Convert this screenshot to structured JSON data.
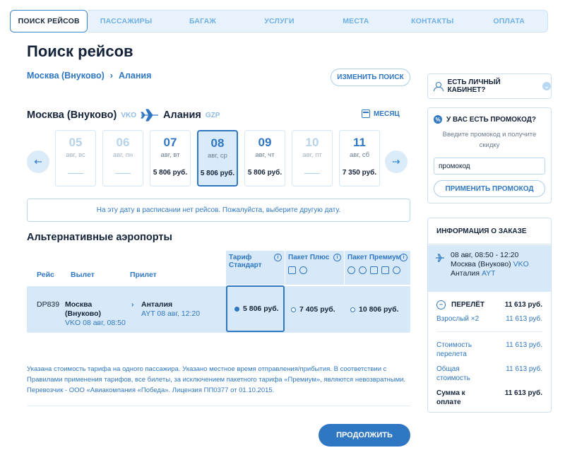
{
  "stepper": [
    "ПОИСК РЕЙСОВ",
    "ПАССАЖИРЫ",
    "БАГАЖ",
    "УСЛУГИ",
    "МЕСТА",
    "КОНТАКТЫ",
    "ОПЛАТА"
  ],
  "active_step": 0,
  "page_title": "Поиск рейсов",
  "breadcrumb": {
    "from": "Москва (Внуково)",
    "sep": "›",
    "to": "Алания"
  },
  "change_search": "ИЗМЕНИТЬ ПОИСК",
  "route": {
    "from": "Москва (Внуково)",
    "from_code": "VKO",
    "to": "Алания",
    "to_code": "GZP"
  },
  "month_label": "МЕСЯЦ",
  "dates": [
    {
      "day": "05",
      "wd": "авг, вс",
      "price": ""
    },
    {
      "day": "06",
      "wd": "авг, пн",
      "price": ""
    },
    {
      "day": "07",
      "wd": "авг, вт",
      "price": "5 806 руб."
    },
    {
      "day": "08",
      "wd": "авг, ср",
      "price": "5 806 руб."
    },
    {
      "day": "09",
      "wd": "авг, чт",
      "price": "5 806 руб."
    },
    {
      "day": "10",
      "wd": "авг, пт",
      "price": ""
    },
    {
      "day": "11",
      "wd": "авг, сб",
      "price": "7 350 руб."
    }
  ],
  "notice": "На эту дату в расписании нет рейсов. Пожалуйста, выберите другую дату.",
  "alt_title": "Альтернативные аэропорты",
  "table": {
    "h_flight": "Рейс",
    "h_dep": "Вылет",
    "h_arr": "Прилет",
    "t_standard": "Тариф Стандарт",
    "t_plus": "Пакет Плюс",
    "t_premium": "Пакет Премиум",
    "flight_no": "DP839",
    "dep_city1": "Москва",
    "dep_city2": "(Внуково)",
    "dep_code": "VKO",
    "dep_time": "08 авг, 08:50",
    "arr_city": "Анталия",
    "arr_code": "AYT",
    "arr_time": "08 авг, 12:20",
    "p_standard": "5 806 руб.",
    "p_plus": "7 405 руб.",
    "p_premium": "10 806 руб."
  },
  "disclaimer": "Указана стоимость тарифа на одного пассажира. Указано местное время отправления/прибытия. В соответствии с Правилами применения тарифов, все билеты, за исключением пакетного тарифа «Премиум», являются невозвратными. Перевозчик - ООО «Авиакомпания «Победа». Лицензия ПП0377 от 01.10.2015.",
  "continue": "ПРОДОЛЖИТЬ",
  "sidebar": {
    "cabinet": "ЕСТЬ ЛИЧНЫЙ КАБИНЕТ?",
    "promo_title": "У ВАС ЕСТЬ ПРОМОКОД?",
    "promo_hint": "Введите промокод и получите скидку",
    "promo_value": "промокод",
    "promo_apply": "ПРИМЕНИТЬ ПРОМОКОД",
    "order_title": "ИНФОРМАЦИЯ О ЗАКАЗЕ",
    "order_time": "08 авг, 08:50 - 12:20",
    "order_from": "Москва (Внуково)",
    "order_from_code": "VKO",
    "order_to": "Анталия",
    "order_to_code": "AYT",
    "flight_lbl": "ПЕРЕЛЁТ",
    "flight_val": "11 613 руб.",
    "adult_lbl": "Взрослый ×2",
    "adult_val": "11 613 руб.",
    "cost_lbl1": "Стоимость",
    "cost_lbl2": "перелета",
    "cost_val": "11 613 руб.",
    "total_lbl1": "Общая",
    "total_lbl2": "стоимость",
    "total_val": "11 613 руб.",
    "pay_lbl1": "Сумма к",
    "pay_lbl2": "оплате",
    "pay_val": "11 613 руб."
  },
  "colors": {
    "accent": "#2f77c2",
    "highlight": "#d7e9f9",
    "text": "#14233a"
  }
}
